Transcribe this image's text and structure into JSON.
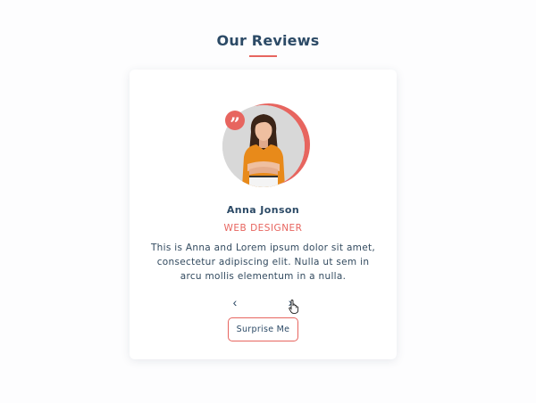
{
  "header": {
    "title": "Our Reviews",
    "accent_color": "#e7655f",
    "title_color": "#2c4a66"
  },
  "review": {
    "name": "Anna Jonson",
    "job": "WEB DESIGNER",
    "text": "This is Anna and Lorem ipsum dolor sit amet, consectetur adipiscing elit. Nulla ut sem in arcu mollis elementum in a nulla.",
    "quote_icon": "quote-icon"
  },
  "controls": {
    "prev_label": "‹",
    "next_label": "›",
    "random_label": "Surprise Me"
  }
}
